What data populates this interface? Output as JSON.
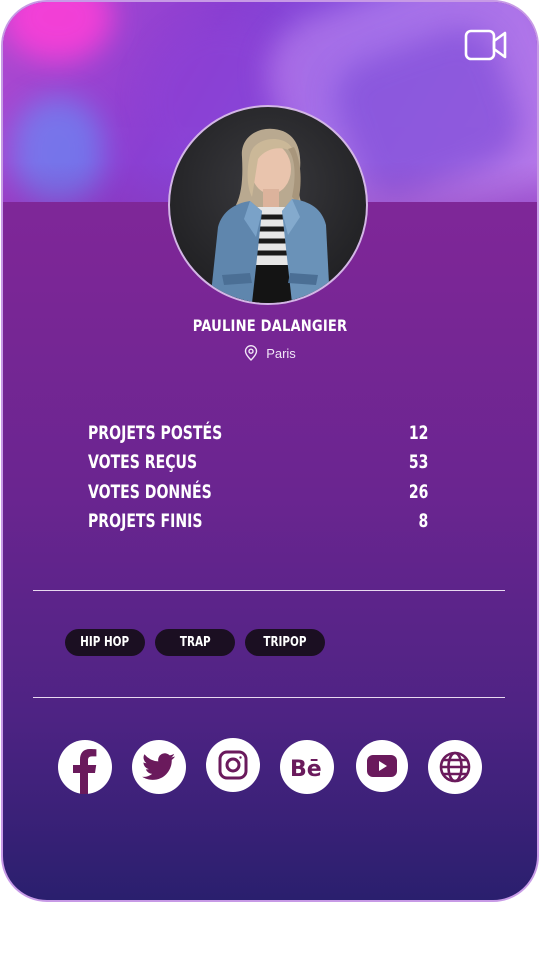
{
  "profile": {
    "name": "PAULINE DALANGIER",
    "location": "Paris"
  },
  "stats": [
    {
      "label": "PROJETS POSTÉS",
      "value": "12"
    },
    {
      "label": "VOTES REÇUS",
      "value": "53"
    },
    {
      "label": "VOTES DONNÉS",
      "value": "26"
    },
    {
      "label": "PROJETS FINIS",
      "value": "8"
    }
  ],
  "tags": [
    "HIP HOP",
    "TRAP",
    "TRIPOP"
  ],
  "socials": [
    "facebook-icon",
    "twitter-icon",
    "instagram-icon",
    "behance-icon",
    "youtube-icon",
    "globe-icon"
  ],
  "colors": {
    "card_top": "#8a2aa0",
    "card_bottom": "#2a1f6e",
    "card_border": "#c79ae6",
    "tag_bg": "#1b0f22",
    "social_icon": "#6a1a5c"
  }
}
